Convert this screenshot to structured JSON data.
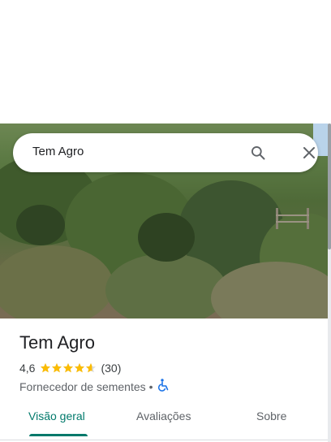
{
  "search": {
    "query": "Tem Agro",
    "search_icon": "search-icon",
    "close_icon": "close-icon"
  },
  "place": {
    "name": "Tem Agro",
    "rating": "4,6",
    "rating_value": 4.6,
    "reviews_count": "(30)",
    "category": "Fornecedor de sementes",
    "separator": "•",
    "accessibility_icon": "wheelchair-icon"
  },
  "tabs": [
    {
      "label": "Visão geral",
      "active": true
    },
    {
      "label": "Avaliações",
      "active": false
    },
    {
      "label": "Sobre",
      "active": false
    }
  ],
  "colors": {
    "accent": "#00796b",
    "star": "#fbbc04",
    "accessibility": "#1a73e8"
  }
}
